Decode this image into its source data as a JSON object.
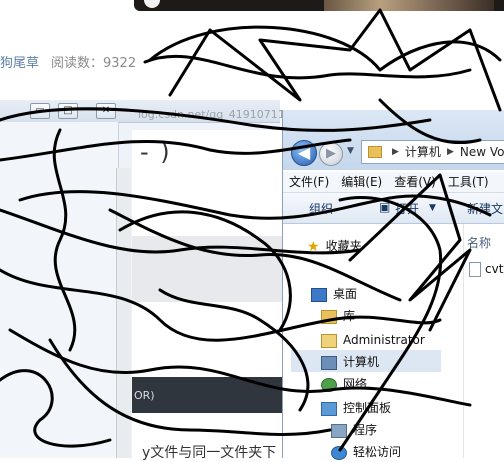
{
  "blog": {
    "author": "狗尾草",
    "read_count": "阅读数：9322"
  },
  "left_window": {
    "url": "log.csdn.net/qq_41910711/",
    "paren_text": "- )",
    "dark_text": "OR)",
    "bottom_text": "y文件与同一文件夹下",
    "buttons": {
      "min": "▭",
      "max": "□",
      "close": "✕"
    }
  },
  "explorer": {
    "back_glyph": "◀",
    "forward_glyph": "▶",
    "breadcrumb": [
      "计算机",
      "New Vo"
    ],
    "menu": [
      "文件(F)",
      "编辑(E)",
      "查看(V)",
      "工具(T)"
    ],
    "commands": {
      "organize": "组织",
      "open": "打开",
      "new_folder": "新建文"
    },
    "nav_items": [
      {
        "label": "收藏夹",
        "icon": "star-icon"
      },
      {
        "label": "桌面",
        "icon": "desktop-icon"
      },
      {
        "label": "库",
        "icon": "library-icon"
      },
      {
        "label": "Administrator",
        "icon": "user-folder-icon"
      },
      {
        "label": "计算机",
        "icon": "computer-icon"
      },
      {
        "label": "网络",
        "icon": "network-icon"
      },
      {
        "label": "控制面板",
        "icon": "control-panel-icon"
      },
      {
        "label": "程序",
        "icon": "programs-icon"
      },
      {
        "label": "轻松访问",
        "icon": "ease-of-access-icon"
      }
    ],
    "column_header": "名称",
    "file_name": "cvt"
  },
  "colors": {
    "scribble": "#000000",
    "link": "#5d7ea6",
    "explorer_chrome": "#c5d7ec"
  }
}
